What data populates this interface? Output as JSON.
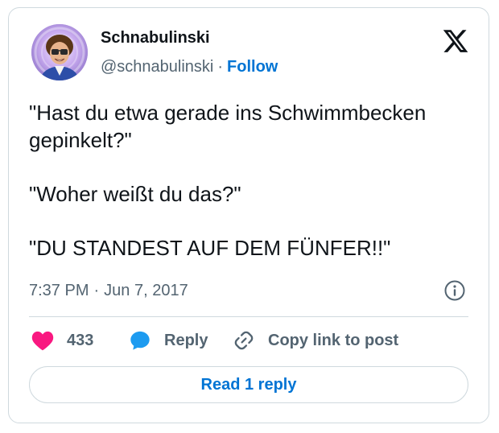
{
  "author": {
    "display_name": "Schnabulinski",
    "handle": "@schnabulinski",
    "separator": "·",
    "follow_label": "Follow",
    "avatar_icon": "profile-photo"
  },
  "platform_icon": "x-logo-icon",
  "tweet": {
    "lines": [
      "\"Hast du etwa gerade ins Schwimmbecken gepinkelt?\"",
      "\"Woher weißt du das?\"",
      "\"DU STANDEST AUF DEM FÜNFER!!\""
    ]
  },
  "meta": {
    "time": "7:37 PM",
    "separator": "·",
    "date": "Jun 7, 2017"
  },
  "actions": {
    "like_count": "433",
    "reply_label": "Reply",
    "copy_label": "Copy link to post"
  },
  "read_reply_label": "Read 1 reply",
  "colors": {
    "accent": "#0074d4",
    "like": "#f91880",
    "muted": "#536471",
    "border": "#cfd9de",
    "text": "#0f1419"
  }
}
